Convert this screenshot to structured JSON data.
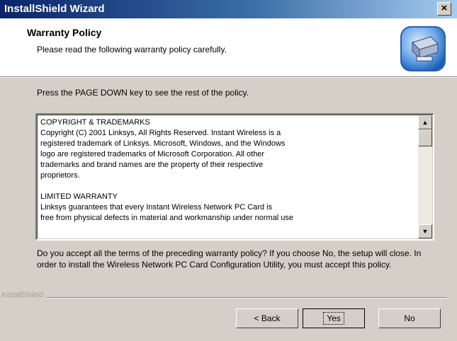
{
  "window": {
    "title": "InstallShield Wizard",
    "close_label": "×"
  },
  "header": {
    "title": "Warranty Policy",
    "subtitle": "Please read the following warranty policy carefully."
  },
  "instruction": "Press the PAGE DOWN key to see the rest of the policy.",
  "policy_text": "COPYRIGHT & TRADEMARKS\nCopyright (C) 2001 Linksys, All Rights Reserved. Instant Wireless is a\nregistered trademark of Linksys. Microsoft, Windows, and the Windows\nlogo are registered trademarks of Microsoft Corporation. All other\ntrademarks and brand names are the property of their respective\nproprietors.\n\nLIMITED WARRANTY\nLinksys guarantees that every Instant Wireless Network PC Card is\nfree from physical defects in material and workmanship under normal use",
  "question": "Do you accept all the terms of the preceding warranty policy? If you choose No, the setup will close. In order to install the Wireless Network PC Card Configuration Utility, you must accept this policy.",
  "brand": "InstallShield",
  "buttons": {
    "back": "< Back",
    "yes": "Yes",
    "no": "No"
  },
  "icons": {
    "header": "computer-setup-icon",
    "scroll_up": "arrow-up-icon",
    "scroll_down": "arrow-down-icon"
  }
}
